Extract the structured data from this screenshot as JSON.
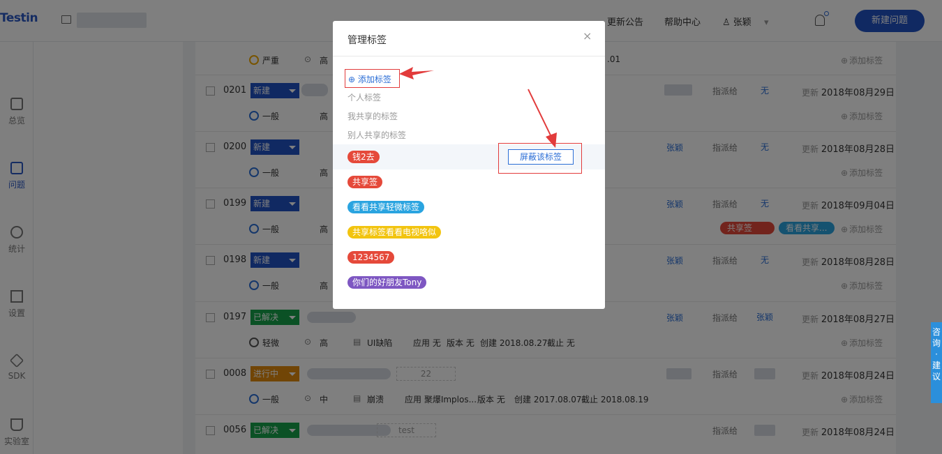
{
  "topbar": {
    "logo": "Testin",
    "nav_announcement": "更新公告",
    "nav_help": "帮助中心",
    "user_name": "张颖",
    "new_issue_label": "新建问题"
  },
  "sidebar": {
    "items": [
      {
        "label": "总览",
        "icon": "home-icon"
      },
      {
        "label": "问题",
        "icon": "question-icon"
      },
      {
        "label": "统计",
        "icon": "chart-icon"
      },
      {
        "label": "设置",
        "icon": "settings-icon"
      },
      {
        "label": "SDK",
        "icon": "layers-icon"
      },
      {
        "label": "实验室",
        "icon": "flask-icon"
      }
    ]
  },
  "list": {
    "add_tag_label": "添加标签",
    "assign_label": "指派给",
    "update_label": "更新",
    "top_row": {
      "severity": "严重",
      "priority": "高",
      "suffix": ".01"
    },
    "rows": [
      {
        "num": "0201",
        "status": "新建",
        "assignee": "",
        "assign_to": "无",
        "updated": "2018年08月29日",
        "severity": "一般",
        "priority": "高"
      },
      {
        "num": "0200",
        "status": "新建",
        "assignee": "张颖",
        "assign_to": "无",
        "updated": "2018年08月28日",
        "severity": "一般",
        "priority": "高"
      },
      {
        "num": "0199",
        "status": "新建",
        "assignee": "张颖",
        "assign_to": "无",
        "updated": "2018年09月04日",
        "severity": "一般",
        "priority": "高",
        "tags": [
          "共享签",
          "看看共享..."
        ]
      },
      {
        "num": "0198",
        "status": "新建",
        "assignee": "张颖",
        "assign_to": "无",
        "updated": "2018年08月28日",
        "severity": "一般",
        "priority": "高"
      },
      {
        "num": "0197",
        "status": "已解决",
        "assignee": "张颖",
        "assign_to": "张颖",
        "updated": "2018年08月27日",
        "severity": "轻微",
        "priority": "高",
        "type": "UI缺陷",
        "app": "应用 无",
        "version": "版本 无",
        "created": "创建 2018.08.27",
        "deadline": "截止 无"
      },
      {
        "num": "0008",
        "status": "进行中",
        "assignee": "",
        "assign_to": "",
        "updated": "2018年08月24日",
        "severity": "一般",
        "priority": "中",
        "type": "崩溃",
        "app": "应用 聚爆Implos...",
        "version": "版本 无",
        "created": "创建 2017.08.07",
        "deadline": "截止 2018.08.19",
        "badge": "22"
      },
      {
        "num": "0056",
        "status": "已解决",
        "assignee": "",
        "assign_to": "",
        "updated": "2018年08月24日",
        "badge": "test"
      }
    ]
  },
  "modal": {
    "title": "管理标签",
    "close": "×",
    "add_tag": "添加标签",
    "categories": [
      "个人标签",
      "我共享的标签",
      "别人共享的标签"
    ],
    "tags": [
      {
        "label": "钱2去",
        "color": "#e5493a"
      },
      {
        "label": "共享签",
        "color": "#e5493a"
      },
      {
        "label": "看看共享轻微标签",
        "color": "#2aa4e0"
      },
      {
        "label": "共享标签看看电视咯似",
        "color": "#f2c40f"
      },
      {
        "label": "1234567",
        "color": "#e5493a"
      },
      {
        "label": "你们的好朋友Tony",
        "color": "#7e57c2"
      }
    ],
    "hide_tag": "屏蔽该标签"
  },
  "feedback": {
    "label": "咨询 · 建议"
  },
  "colors": {
    "brand": "#2152c5",
    "new_status": "#2152c5",
    "resolved_status": "#17a34a",
    "inprogress_status": "#e38a0c",
    "annotation_red": "#e23b3b"
  }
}
